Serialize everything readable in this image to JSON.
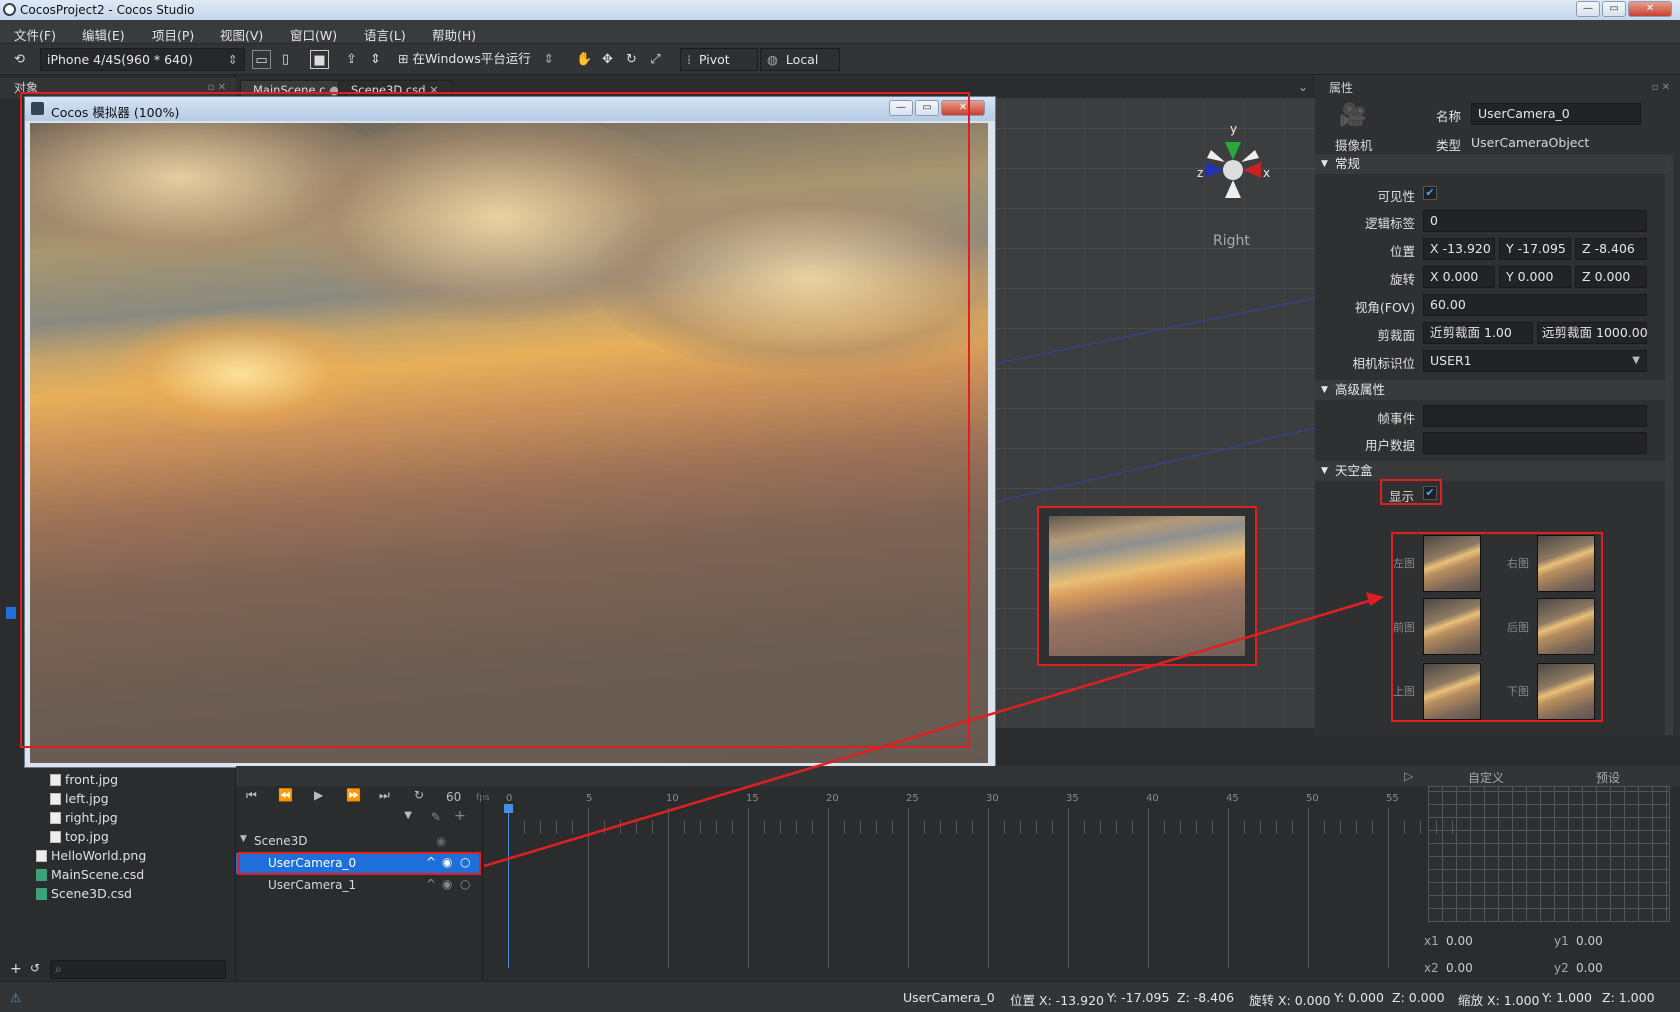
{
  "window": {
    "title": "CocosProject2 - Cocos Studio"
  },
  "menu": [
    "文件(F)",
    "编辑(E)",
    "项目(P)",
    "视图(V)",
    "窗口(W)",
    "语言(L)",
    "帮助(H)"
  ],
  "toolbar": {
    "device": "iPhone 4/4S(960 * 640)",
    "run_target": "在Windows平台运行",
    "pivot": "Pivot",
    "local": "Local"
  },
  "left_panel": {
    "title": "对象",
    "files": [
      "front.jpg",
      "left.jpg",
      "right.jpg",
      "top.jpg"
    ],
    "root_files": [
      "HelloWorld.png",
      "MainScene.csd",
      "Scene3D.csd"
    ]
  },
  "tabs": [
    "MainScene.c",
    "Scene3D.csd"
  ],
  "simulator": {
    "title": "Cocos 模拟器 (100%)"
  },
  "scene": {
    "gizmo": {
      "y": "y",
      "z": "z",
      "x": "x",
      "view": "Right"
    }
  },
  "properties": {
    "title": "属性",
    "camera_label": "摄像机",
    "name_label": "名称",
    "name_value": "UserCamera_0",
    "type_label": "类型",
    "type_value": "UserCameraObject",
    "sections": {
      "general": "常规",
      "advanced": "高级属性",
      "skybox": "天空盒"
    },
    "visible_label": "可见性",
    "visible": true,
    "tag_label": "逻辑标签",
    "tag_value": "0",
    "position_label": "位置",
    "position": {
      "x": "-13.920",
      "y": "-17.095",
      "z": "-8.406"
    },
    "rotation_label": "旋转",
    "rotation": {
      "x": "0.000",
      "y": "0.000",
      "z": "0.000"
    },
    "fov_label": "视角(FOV)",
    "fov_value": "60.00",
    "clip_label": "剪裁面",
    "near_label": "近剪裁面",
    "near_value": "1.00",
    "far_label": "远剪裁面",
    "far_value": "1000.00",
    "camflag_label": "相机标识位",
    "camflag_value": "USER1",
    "frame_event_label": "帧事件",
    "user_data_label": "用户数据",
    "skybox_show_label": "显示",
    "skybox_show": true,
    "faces": [
      "左图",
      "右图",
      "前图",
      "后图",
      "上图",
      "下图"
    ],
    "axis_x": "X",
    "axis_y": "Y",
    "axis_z": "Z"
  },
  "timeline": {
    "fps": "60",
    "fps_unit": "fps",
    "ticks": [
      "0",
      "5",
      "10",
      "15",
      "20",
      "25",
      "30",
      "35",
      "40",
      "45",
      "50",
      "55"
    ],
    "root": "Scene3D",
    "items": [
      "UserCamera_0",
      "UserCamera_1"
    ]
  },
  "curve_panel": {
    "custom": "自定义",
    "preset": "预设",
    "x1_label": "x1",
    "x1": "0.00",
    "y1_label": "y1",
    "y1": "0.00",
    "x2_label": "x2",
    "x2": "0.00",
    "y2_label": "y2",
    "y2": "0.00"
  },
  "status": {
    "object": "UserCamera_0",
    "position": "位置 X: -13.920",
    "pos_y": "Y: -17.095",
    "pos_z": "Z: -8.406",
    "rotation": "旋转 X: 0.000",
    "rot_y": "Y: 0.000",
    "rot_z": "Z: 0.000",
    "scale": "缩放 X: 1.000",
    "scale_y": "Y: 1.000",
    "scale_z": "Z: 1.000"
  },
  "colors": {
    "accent": "#1e6fd9",
    "highlight": "#e02020"
  }
}
